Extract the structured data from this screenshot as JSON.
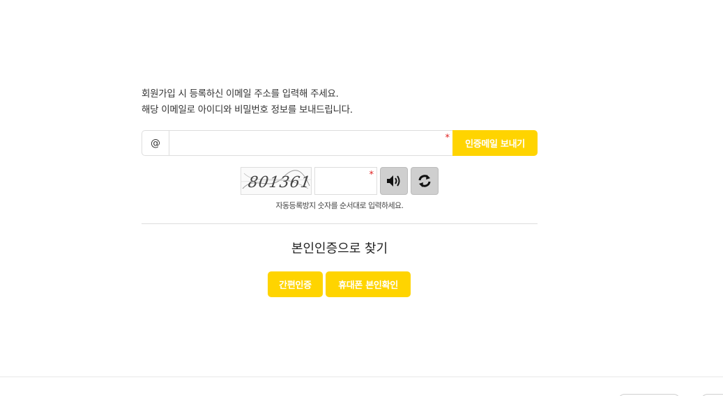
{
  "intro": {
    "line1": "회원가입 시 등록하신 이메일 주소를 입력해 주세요.",
    "line2": "해당 이메일로 아이디와 비밀번호 정보를 보내드립니다."
  },
  "email": {
    "prefix": "@",
    "value": "",
    "placeholder": "",
    "required_mark": "*",
    "send_button": "인증메일 보내기"
  },
  "captcha": {
    "image_text": "801361",
    "value": "",
    "required_mark": "*",
    "audio_icon": "speaker-icon",
    "refresh_icon": "refresh-icon",
    "help_text": "자동등록방지 숫자를 순서대로 입력하세요."
  },
  "identity": {
    "title": "본인인증으로 찾기",
    "simple_auth_button": "간편인증",
    "phone_auth_button": "휴대폰 본인확인"
  },
  "colors": {
    "accent": "#ffd400",
    "required": "#e02020",
    "gray_button": "#cfcfcf"
  }
}
